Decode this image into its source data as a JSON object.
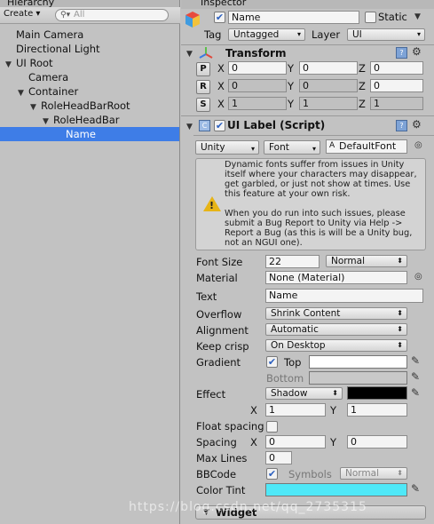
{
  "hierarchy": {
    "tab_title": "Hierarchy",
    "create_label": "Create ▾",
    "search_placeholder": "All",
    "items": [
      {
        "label": "Main Camera"
      },
      {
        "label": "Directional Light"
      },
      {
        "label": "UI Root"
      },
      {
        "label": "Camera"
      },
      {
        "label": "Container"
      },
      {
        "label": "RoleHeadBarRoot"
      },
      {
        "label": "RoleHeadBar"
      },
      {
        "label": "Name"
      }
    ],
    "selected": "Name"
  },
  "inspector": {
    "tab_title": "Inspector",
    "object_name": "Name",
    "active_checked": true,
    "static_label": "Static",
    "tag_label": "Tag",
    "tag_value": "Untagged",
    "layer_label": "Layer",
    "layer_value": "UI",
    "transform": {
      "title": "Transform",
      "p_btn": "P",
      "r_btn": "R",
      "s_btn": "S",
      "x": "X",
      "y": "Y",
      "z": "Z",
      "position": [
        "0",
        "0",
        "0"
      ],
      "rotation": [
        "0",
        "0",
        "0"
      ],
      "scale": [
        "1",
        "1",
        "1"
      ]
    },
    "ui_label": {
      "title": "UI Label (Script)",
      "font_type": "Unity",
      "font_dropdown": "Font",
      "font_value": "DefaultFont",
      "help_text": "Dynamic fonts suffer from issues in Unity itself where your characters may disappear, get garbled, or just not show at times. Use this feature at your own risk.\n\nWhen you do run into such issues, please submit a Bug Report to Unity via Help -> Report a Bug (as this is will be a Unity bug, not an NGUI one).",
      "font_size_label": "Font Size",
      "font_size_value": "22",
      "font_style_value": "Normal",
      "material_label": "Material",
      "material_value": "None (Material)",
      "text_label": "Text",
      "text_value": "Name",
      "overflow_label": "Overflow",
      "overflow_value": "Shrink Content",
      "alignment_label": "Alignment",
      "alignment_value": "Automatic",
      "keep_crisp_label": "Keep crisp",
      "keep_crisp_value": "On Desktop",
      "gradient_label": "Gradient",
      "gradient_checked": true,
      "top_label": "Top",
      "bottom_label": "Bottom",
      "gradient_top_color": "#ffffff",
      "gradient_bottom_color": "#c8c8c8",
      "effect_label": "Effect",
      "effect_value": "Shadow",
      "effect_color": "#000000",
      "effect_x_label": "X",
      "effect_x_value": "1",
      "effect_y_label": "Y",
      "effect_y_value": "1",
      "float_spacing_label": "Float spacing",
      "spacing_label": "Spacing",
      "spacing_x_label": "X",
      "spacing_x_value": "0",
      "spacing_y_label": "Y",
      "spacing_y_value": "0",
      "max_lines_label": "Max Lines",
      "max_lines_value": "0",
      "bbcode_label": "BBCode",
      "bbcode_checked": true,
      "symbols_label": "Symbols",
      "symbols_value": "Normal",
      "color_tint_label": "Color Tint",
      "color_tint": "#4fe8f7"
    },
    "widget_title": "Widget"
  },
  "watermark": "https://blog.csdn.net/qq_2735315"
}
